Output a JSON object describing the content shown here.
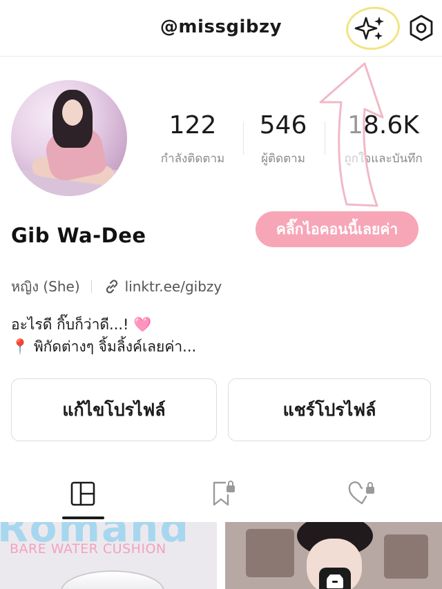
{
  "header": {
    "username": "@missgibzy",
    "sparkle_icon": "sparkles-icon",
    "settings_icon": "hexagon-settings-icon",
    "highlight_color": "#f3e47f"
  },
  "profile": {
    "display_name": "Gib Wa-Dee",
    "stats": [
      {
        "value": "122",
        "label": "กำลังติดตาม"
      },
      {
        "value": "546",
        "label": "ผู้ติดตาม"
      },
      {
        "value": "18.6K",
        "label": "ถูกใจและบันทึก"
      }
    ],
    "pronoun": "หญิง (She)",
    "link": "linktr.ee/gibzy",
    "bio_line1": "อะไรดี กิ๊บก็ว่าดี...!",
    "bio_line2": "พิกัดต่างๆ จิ้มลิ้งค์เลยค่า...",
    "bio_heart": "🩷",
    "bio_pin": "📍"
  },
  "annotation": {
    "callout": "คลิ๊กไอคอนนี้เลยค่า",
    "callout_color": "#f7a6b7"
  },
  "actions": {
    "edit_label": "แก้ไขโปรไฟล์",
    "share_label": "แชร์โปรไฟล์"
  },
  "tabs": [
    {
      "icon": "grid-posts-icon",
      "active": true
    },
    {
      "icon": "saved-locked-icon",
      "active": false
    },
    {
      "icon": "liked-locked-icon",
      "active": false
    }
  ],
  "posts": [
    {
      "overlay_text": "BARE WATER CUSHION",
      "headline": "Romand"
    },
    {
      "overlay_text": "",
      "headline": ""
    }
  ]
}
